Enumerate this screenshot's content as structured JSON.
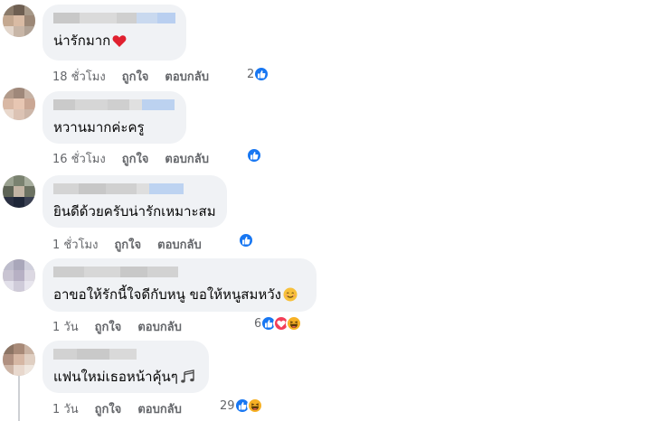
{
  "comments": [
    {
      "text": "น่ารักมาก",
      "emoji_icon": "heart-icon",
      "time": "18 ชั่วโมง",
      "like_label": "ถูกใจ",
      "reply_label": "ตอบกลับ",
      "reaction_count": "2",
      "reactions": [
        "like"
      ]
    },
    {
      "text": "หวานมากค่ะครู",
      "emoji_icon": "",
      "time": "16 ชั่วโมง",
      "like_label": "ถูกใจ",
      "reply_label": "ตอบกลับ",
      "reaction_count": "",
      "reactions": [
        "like"
      ]
    },
    {
      "text": "ยินดีด้วยครับน่ารักเหมาะสม",
      "emoji_icon": "",
      "time": "1 ชั่วโมง",
      "like_label": "ถูกใจ",
      "reply_label": "ตอบกลับ",
      "reaction_count": "",
      "reactions": [
        "like"
      ]
    },
    {
      "text": "อาขอให้รักนี้ใจดีกับหนู ขอให้หนูสมหวัง",
      "emoji_icon": "smiling-face-icon",
      "time": "1 วัน",
      "like_label": "ถูกใจ",
      "reply_label": "ตอบกลับ",
      "reaction_count": "6",
      "reactions": [
        "like",
        "love",
        "haha"
      ]
    },
    {
      "text": "แฟนใหม่เธอหน้าคุ้นๆ",
      "emoji_icon": "musical-notes-icon",
      "time": "1 วัน",
      "like_label": "ถูกใจ",
      "reply_label": "ตอบกลับ",
      "reaction_count": "29",
      "reactions": [
        "like",
        "haha"
      ]
    }
  ],
  "colors": {
    "bubble": "#f0f2f5",
    "like_blue": "#1877f2",
    "love_red": "#f33e58",
    "haha_yellow": "#f7b125",
    "meta_gray": "#65676b"
  }
}
